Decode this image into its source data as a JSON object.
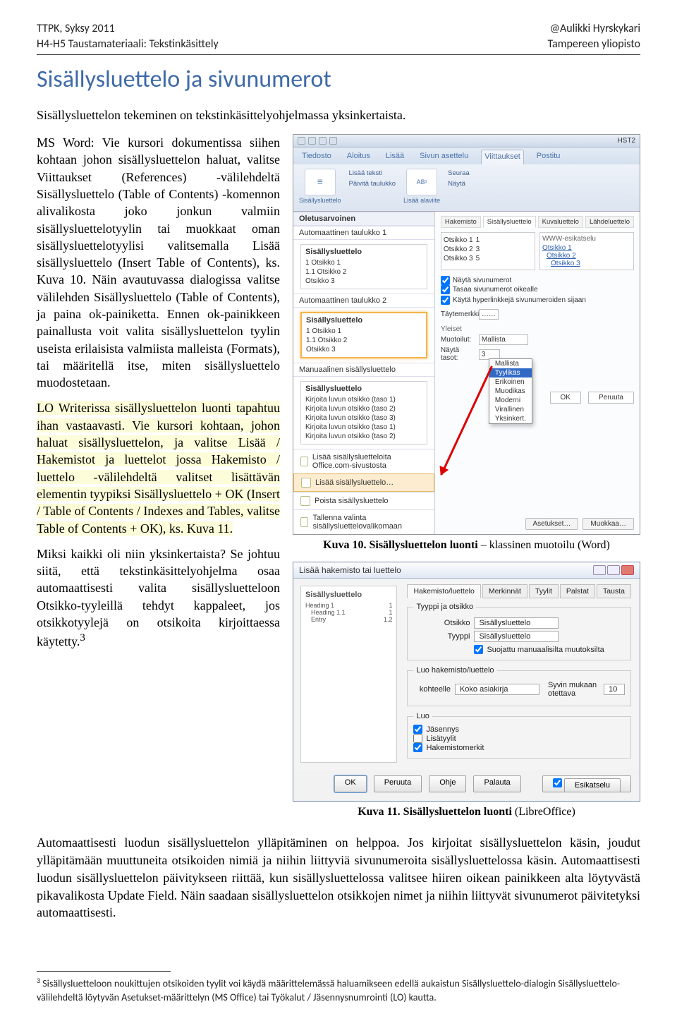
{
  "header": {
    "left1": "TTPK, Syksy 2011",
    "left2": "H4-H5 Taustamateriaali: Tekstinkäsittely",
    "right1": "@Aulikki Hyrskykari",
    "right2": "Tampereen yliopisto"
  },
  "title": "Sisällysluettelo ja sivunumerot",
  "intro": "Sisällysluettelon tekeminen on tekstinkäsittelyohjelmassa yksinkertaista.",
  "para_msword": "MS Word: Vie kursori dokumentissa siihen kohtaan johon sisällysluettelon haluat, valitse Viittaukset (References) -välilehdeltä Sisällysluettelo (Table of Contents) -komennon alivalikosta joko jonkun valmiin sisällysluettelotyylin tai muokkaat oman sisällysluettelotyylisi valitsemalla Lisää sisällysluettelo (Insert Table of Contents), ks. Kuva 10. Näin avautuvassa dialogissa valitse välilehden Sisällysluettelo (Table of Contents), ja paina ok-painiketta. Ennen ok-painikkeen painallusta voit valita sisällysluettelon tyylin useista erilaisista valmiista malleista (Formats), tai määritellä itse, miten sisällysluettelo muodostetaan.",
  "para_lo": "LO Writerissa sisällysluettelon luonti tapahtuu ihan vastaavasti. Vie kursori kohtaan, johon haluat sisällysluettelon, ja valitse Lisää / Hakemistot ja luettelot jossa Hakemisto / luettelo -välilehdeltä valitset lisättävän elementin tyypiksi Sisällysluettelo + OK (Insert / Table of Contents / Indexes and Tables, valitse Table of Contents + OK), ks. Kuva 11.",
  "para_why_start": "Miksi kaikki oli niin yksinkertaista? Se johtuu siitä, että tekstinkäsittelyohjelma osaa automaattisesti valita sisällysluetteloon Otsikko-tyyleillä tehdyt kappaleet, jos otsikkotyylejä on otsikoita kirjoittaessa käytetty.",
  "para_why_cont": "Automaattisesti luodun sisällysluettelon ylläpitäminen on helppoa. Jos kirjoitat sisällysluettelon käsin, joudut ylläpitämään muuttuneita otsikoiden nimiä ja niihin liittyviä sivunumeroita sisällysluettelossa käsin. Automaattisesti luodun sisällysluettelon päivitykseen riittää, kun sisällysluettelossa valitsee hiiren oikean painikkeen alta löytyvästä pikavalikosta Update Field. Näin saadaan sisällysluettelon otsikkojen nimet ja niihin liittyvät sivunumerot päivitetyksi automaattisesti.",
  "footnote_ref": "3",
  "caption10_strong": "Kuva 10. Sisällysluettelon luonti",
  "caption10_rest": " – klassinen muotoilu (Word)",
  "caption11_strong": "Kuva 11. Sisällysluettelon luonti",
  "caption11_rest": " (LibreOffice)",
  "footnote_num": "3",
  "footnote_text": " Sisällysluetteloon noukittujen otsikoiden tyylit voi käydä määrittelemässä haluamikseen edellä aukaistun Sisällysluettelo-dialogin Sisällysluettelo-välilehdeltä löytyvän Asetukset-määrittelyn (MS Office) tai Työkalut / Jäsennysnumrointi (LO) kautta.",
  "fig10": {
    "doc_title": "HST2",
    "tabs": [
      "Tiedosto",
      "Aloitus",
      "Lisää",
      "Sivun asettelu",
      "Viittaukset",
      "Postitu"
    ],
    "active_tab_index": 4,
    "ribbon": {
      "btn_toc": "Sisällysluettelo",
      "btn_addtext": "Lisää teksti",
      "btn_update": "Päivitä taulukko",
      "btn_footnote": "Lisää alaviite",
      "ab1": "AB¹",
      "btn_seuraa": "Seuraa",
      "btn_nayta": "Näytä"
    },
    "gallery": {
      "valmis_title": "Oletusarvoinen",
      "auto1_title": "Automaattinen taulukko 1",
      "auto2_title": "Automaattinen taulukko 2",
      "manual_title": "Manuaalinen sisällysluettelo",
      "thumb_title": "Sisällysluettelo",
      "rows_auto": [
        "1  Otsikko 1",
        "  1.1  Otsikko 2",
        "    Otsikko 3"
      ],
      "rows_sisalto": [
        "1  Otsikko 1",
        "  1.1  Otsikko 2",
        "    Otsikko 3"
      ],
      "rows_manual": [
        "Kirjoita luvun otsikko (taso 1)",
        "  Kirjoita luvun otsikko (taso 2)",
        "    Kirjoita luvun otsikko (taso 3)",
        "Kirjoita luvun otsikko (taso 1)",
        "  Kirjoita luvun otsikko (taso 2)"
      ],
      "footer_office": "Lisää sisällysluetteloita Office.com-sivustosta",
      "footer_insert": "Lisää sisällysluettelo…",
      "footer_remove": "Poista sisällysluettelo",
      "footer_save": "Tallenna valinta sisällysluettelovalikomaan"
    },
    "panel": {
      "tabs": [
        "Hakemisto",
        "Sisällysluettelo",
        "Kuvaluettelo",
        "Lähdeluettelo"
      ],
      "active_tab": 1,
      "preview_items": [
        {
          "label": "Otsikko 1",
          "page": "1"
        },
        {
          "label": "Otsikko 2",
          "page": "3"
        },
        {
          "label": "Otsikko 3",
          "page": "5"
        }
      ],
      "www_label": "WWW-esikatselu",
      "www_items": [
        "Otsikko 1",
        "Otsikko 2",
        "Otsikko 3"
      ],
      "chk_show_pages": "Näytä sivunumerot",
      "chk_align_right": "Tasaa sivunumerot oikealle",
      "chk_hyperlinks": "Käytä hyperlinkkejä sivunumeroiden sijaan",
      "taytemerk_label": "Täytemerkki:",
      "taytemerk_value": "……",
      "yleiset_label": "Yleiset",
      "muotoilut_label": "Muotoilut:",
      "muotoilut_value": "Mallista",
      "nayta_tasot_label": "Näytä tasot:",
      "nayta_tasot_value": "3",
      "dropdown_options": [
        "Mallista",
        "Tyylikäs",
        "Erikoinen",
        "Muodikas",
        "Moderni",
        "Virallinen",
        "Yksinkert."
      ],
      "dropdown_selected_index": 1,
      "btn_asetukset": "Asetukset…",
      "btn_muokkaa": "Muokkaa…",
      "btn_ok": "OK",
      "btn_peruuta": "Peruuta"
    }
  },
  "fig11": {
    "titlebar": "Lisää hakemisto tai luettelo",
    "tabs": [
      "Hakemisto/luettelo",
      "Merkinnät",
      "Tyylit",
      "Palstat",
      "Tausta"
    ],
    "active_tab": 0,
    "preview": {
      "title": "Sisällysluettelo",
      "rows": [
        {
          "l": "Heading 1",
          "r": "1"
        },
        {
          "l": "Heading 1.1",
          "r": "1"
        },
        {
          "l": "Entry",
          "r": "1.2"
        }
      ]
    },
    "group_type_legend": "Tyyppi ja otsikko",
    "lbl_otsikko": "Otsikko",
    "val_otsikko": "Sisällysluettelo",
    "lbl_tyyppi": "Tyyppi",
    "val_tyyppi": "Sisällysluettelo",
    "chk_protect": "Suojattu manuaalisilta muutoksilta",
    "group_create_legend": "Luo hakemisto/luettelo",
    "lbl_kohteelle": "kohteelle",
    "val_kohteelle": "Koko asiakirja",
    "lbl_syvin": "Syvin mukaan otettava",
    "val_syvin": "10",
    "group_from_legend": "Luo",
    "chk_jasennys": "Jäsennys",
    "chk_lisatyylit": "Lisätyylit",
    "chk_hakemmerkit": "Hakemistomerkit",
    "btns": {
      "ok": "OK",
      "peruuta": "Peruuta",
      "ohje": "Ohje",
      "palauta": "Palauta",
      "esikatselu": "Esikatselu"
    }
  }
}
